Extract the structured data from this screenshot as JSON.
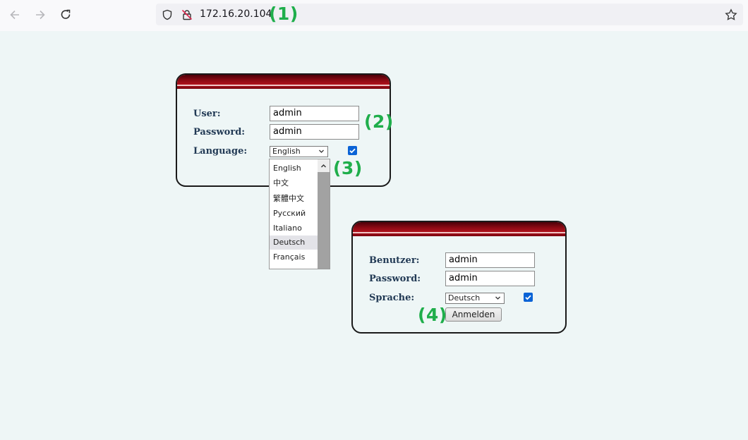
{
  "browser": {
    "url": "172.16.20.104",
    "icons": [
      "back-arrow-icon",
      "forward-arrow-icon",
      "reload-icon",
      "shield-icon",
      "insecure-lock-icon",
      "star-icon"
    ]
  },
  "annotations": [
    "(1)",
    "(2)",
    "(3)",
    "(4)"
  ],
  "login_english": {
    "user_label": "User:",
    "user_value": "admin",
    "password_label": "Password:",
    "password_value": "admin",
    "language_label": "Language:",
    "language_selected": "English",
    "remember_checked": true
  },
  "language_dropdown": {
    "options": [
      "English",
      "中文",
      "繁體中文",
      "Русский",
      "Italiano",
      "Deutsch",
      "Français"
    ],
    "highlighted": "Deutsch"
  },
  "login_german": {
    "user_label": "Benutzer:",
    "user_value": "admin",
    "password_label": "Password:",
    "password_value": "admin",
    "language_label": "Sprache:",
    "language_selected": "Deutsch",
    "remember_checked": true,
    "login_button": "Anmelden"
  },
  "colors": {
    "annotation": "#1fae4b",
    "header_red": "#8e0a14",
    "label": "#223a55",
    "checkbox": "#0b63d6",
    "page_bg": "#eef6f6"
  }
}
